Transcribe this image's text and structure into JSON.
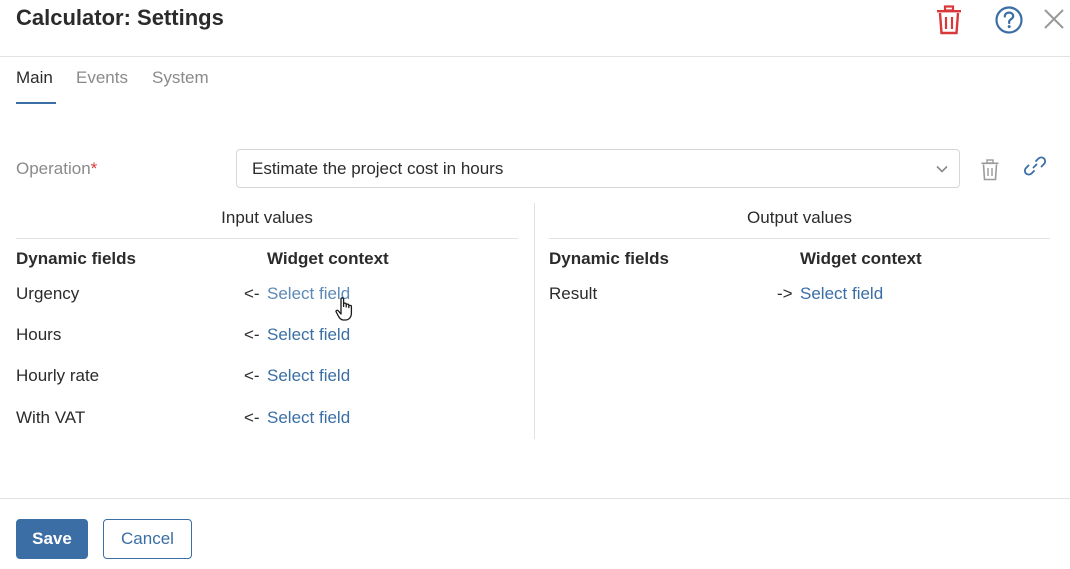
{
  "header": {
    "title": "Calculator: Settings",
    "delete_icon": "trash-icon",
    "help_icon": "help-circle-icon",
    "close_icon": "close-icon"
  },
  "tabs": [
    {
      "label": "Main",
      "active": true
    },
    {
      "label": "Events",
      "active": false
    },
    {
      "label": "System",
      "active": false
    }
  ],
  "operation": {
    "label": "Operation",
    "required_mark": "*",
    "value": "Estimate the project cost in hours",
    "dropdown_icon": "chevron-down-icon",
    "delete_icon": "trash-icon",
    "link_icon": "link-icon"
  },
  "input_values": {
    "title": "Input values",
    "col_dynamic": "Dynamic fields",
    "col_context": "Widget context",
    "rows": [
      {
        "field": "Urgency",
        "arrow": "<-",
        "action": "Select field"
      },
      {
        "field": "Hours",
        "arrow": "<-",
        "action": "Select field"
      },
      {
        "field": "Hourly rate",
        "arrow": "<-",
        "action": "Select field"
      },
      {
        "field": "With VAT",
        "arrow": "<-",
        "action": "Select field"
      }
    ]
  },
  "output_values": {
    "title": "Output values",
    "col_dynamic": "Dynamic fields",
    "col_context": "Widget context",
    "rows": [
      {
        "field": "Result",
        "arrow": "->",
        "action": "Select field"
      }
    ]
  },
  "footer": {
    "save_label": "Save",
    "cancel_label": "Cancel"
  },
  "colors": {
    "accent": "#3a6ea5",
    "danger": "#d9383a",
    "muted_text": "#8a8a8a"
  }
}
